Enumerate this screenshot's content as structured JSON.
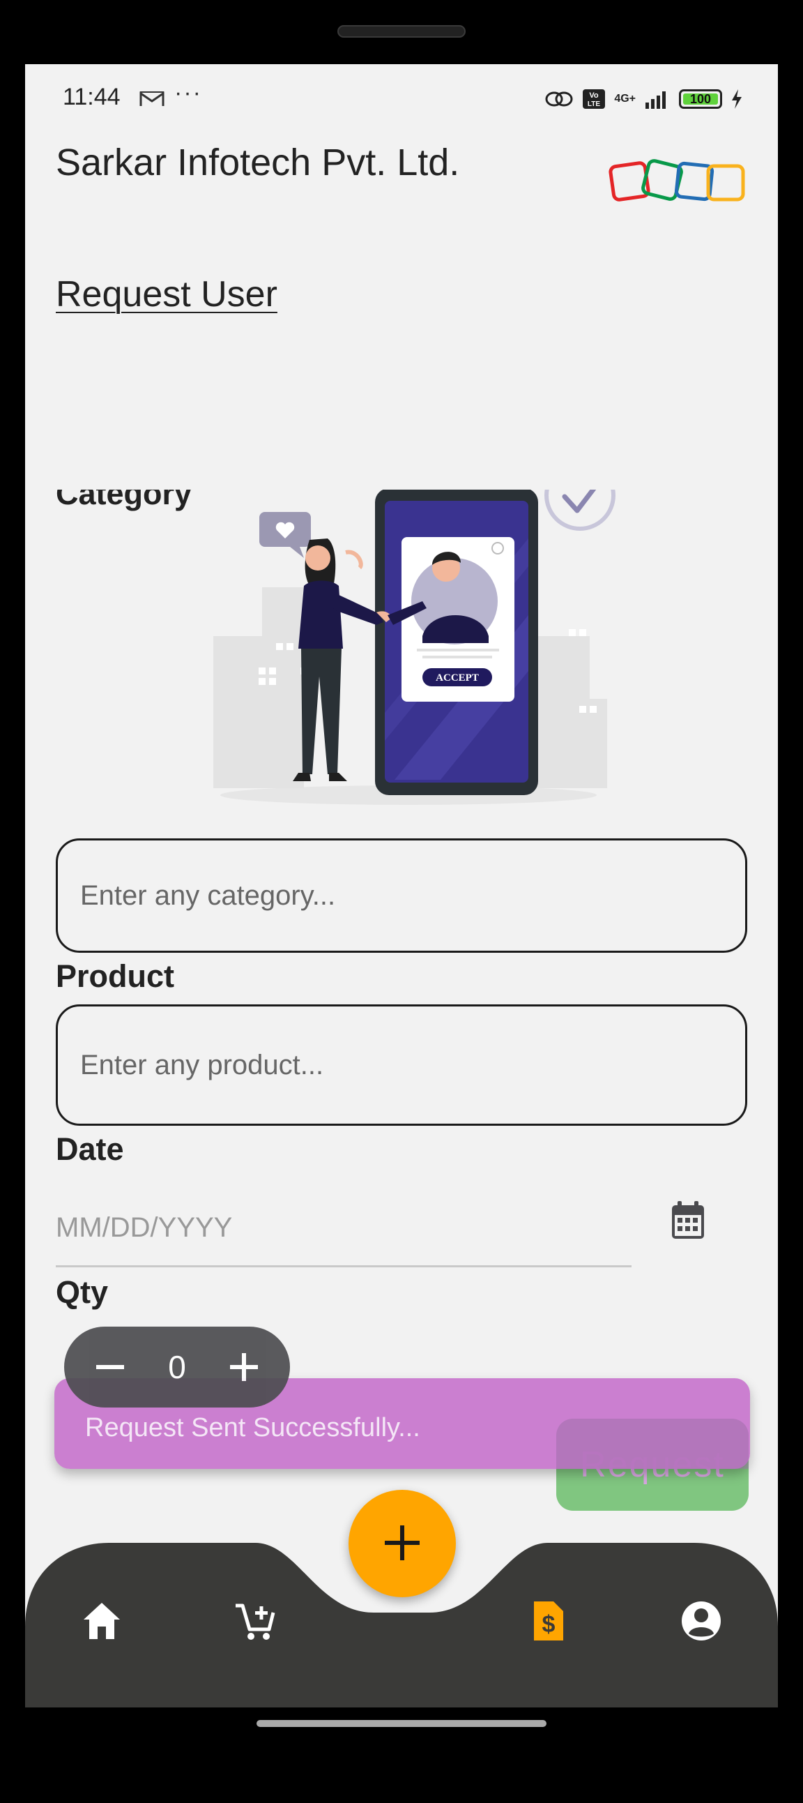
{
  "status_bar": {
    "time": "11:44",
    "network_label": "4G+",
    "volte_label": "Vo LTE",
    "battery": "100",
    "more": "···"
  },
  "header": {
    "company_name": "Sarkar Infotech Pvt. Ltd.",
    "page_title": "Request User"
  },
  "illustration": {
    "accept_label": "ACCEPT"
  },
  "form": {
    "category": {
      "label": "Category",
      "placeholder": "Enter any category..."
    },
    "product": {
      "label": "Product",
      "placeholder": "Enter any product..."
    },
    "date": {
      "placeholder": "MM/DD/YYYY",
      "label": "Date"
    },
    "qty": {
      "label": "Qty",
      "value": "0"
    },
    "request_label": "Request"
  },
  "snackbar": {
    "message": "Request Sent Successfully..."
  },
  "bottom_nav": {
    "items": [
      "home-icon",
      "cart-add-icon",
      "add-icon",
      "invoice-dollar-icon",
      "account-icon"
    ],
    "active": "invoice-dollar-icon",
    "colors": {
      "bar": "#3a3a38",
      "fab": "#ffa500",
      "active": "#ffa500",
      "inactive": "#ffffff"
    }
  }
}
